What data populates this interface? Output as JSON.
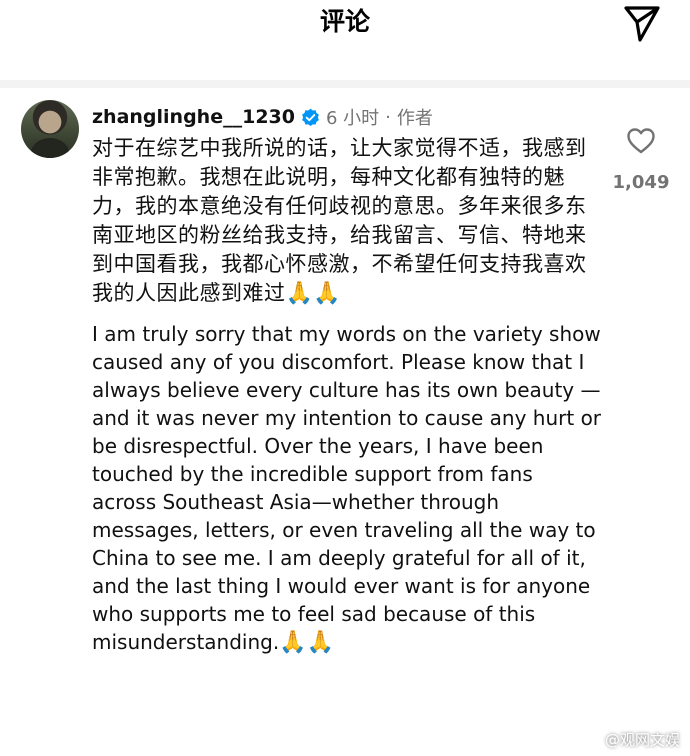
{
  "header": {
    "title": "评论",
    "share_icon": "send-icon"
  },
  "comment": {
    "username": "zhanglinghe__1230",
    "verified_icon": "verified-badge-icon",
    "time": "6 小时",
    "separator": "·",
    "author_tag": "作者",
    "text_cn": "对于在综艺中我所说的话，让大家觉得不适，我感到非常抱歉。我想在此说明，每种文化都有独特的魅力，我的本意绝没有任何歧视的意思。多年来很多东南亚地区的粉丝给我支持，给我留言、写信、特地来到中国看我，我都心怀感激，不希望任何支持我喜欢我的人因此感到难过",
    "text_cn_emoji": "🙏🙏",
    "text_en": "I am truly sorry that my words on the variety show caused any of you discomfort. Please know that I always believe every culture has its own beauty — and it was never my intention to cause any hurt or be disrespectful. Over the years, I have been touched by the incredible support from fans across Southeast Asia—whether through messages, letters, or even traveling all the way to China to see me. I am deeply grateful for all of it, and the last thing I would ever want is for anyone who supports me to feel sad because of this misunderstanding.",
    "text_en_emoji": "🙏🙏",
    "like_icon": "heart-icon",
    "like_count": "1,049"
  },
  "watermark": {
    "text": "@观网文娱",
    "icon": "weibo-icon"
  },
  "colors": {
    "text_primary": "#111111",
    "text_secondary": "#737373",
    "verified_blue": "#0095f6",
    "separator_bar": "#f3f3f3"
  }
}
